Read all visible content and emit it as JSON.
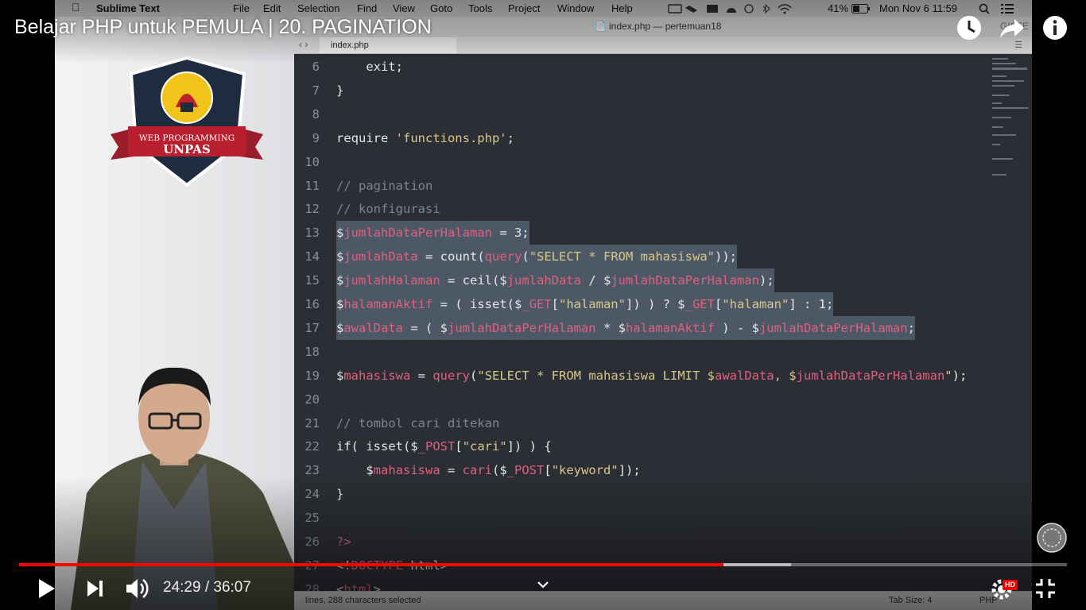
{
  "video": {
    "title": "Belajar PHP untuk PEMULA | 20. PAGINATION",
    "current_time": "24:29",
    "duration": "36:07",
    "time_display": "24:29 / 36:07",
    "played_fraction": 0.672,
    "buffered_fraction": 0.737,
    "hd_badge": "HD",
    "icons": {
      "watch_later": "clock-icon",
      "share": "share-icon",
      "info": "info-icon",
      "play": "play-icon",
      "next": "next-icon",
      "volume": "volume-icon",
      "settings": "gear-icon",
      "exit_fullscreen": "exit-fullscreen-icon",
      "chevron": "chevron-down-icon",
      "channel_watermark": "channel-watermark-icon"
    }
  },
  "mac_menubar": {
    "app": "Sublime Text",
    "menus": [
      "File",
      "Edit",
      "Selection",
      "Find",
      "View",
      "Goto",
      "Tools",
      "Project",
      "Window",
      "Help"
    ],
    "battery": "41%",
    "clock": "Mon Nov 6  11:59"
  },
  "logo": {
    "line1": "WEB PROGRAMMING",
    "line2": "UNPAS"
  },
  "editor": {
    "window_title": "index.php — pertemuan18",
    "tab_label": "index.php",
    "register_hint": "GISTE",
    "status_left": "lines, 288 characters selected",
    "tab_size": "Tab Size: 4",
    "syntax": "PHP",
    "lines": [
      {
        "n": "6",
        "t": "    exit;",
        "sel": false
      },
      {
        "n": "7",
        "t": "}",
        "sel": false
      },
      {
        "n": "8",
        "t": "",
        "sel": false
      },
      {
        "n": "9",
        "t": "require 'functions.php';",
        "sel": false
      },
      {
        "n": "10",
        "t": "",
        "sel": false
      },
      {
        "n": "11",
        "t": "// pagination",
        "sel": false
      },
      {
        "n": "12",
        "t": "// konfigurasi",
        "sel": false
      },
      {
        "n": "13",
        "t": "$jumlahDataPerHalaman = 3;",
        "sel": true
      },
      {
        "n": "14",
        "t": "$jumlahData = count(query(\"SELECT * FROM mahasiswa\"));",
        "sel": true
      },
      {
        "n": "15",
        "t": "$jumlahHalaman = ceil($jumlahData / $jumlahDataPerHalaman);",
        "sel": true
      },
      {
        "n": "16",
        "t": "$halamanAktif = ( isset($_GET[\"halaman\"]) ) ? $_GET[\"halaman\"] : 1;",
        "sel": true
      },
      {
        "n": "17",
        "t": "$awalData = ( $jumlahDataPerHalaman * $halamanAktif ) - $jumlahDataPerHalaman;",
        "sel": true
      },
      {
        "n": "18",
        "t": "",
        "sel": false
      },
      {
        "n": "19",
        "t": "$mahasiswa = query(\"SELECT * FROM mahasiswa LIMIT $awalData, $jumlahDataPerHalaman\");",
        "sel": false
      },
      {
        "n": "20",
        "t": "",
        "sel": false
      },
      {
        "n": "21",
        "t": "// tombol cari ditekan",
        "sel": false
      },
      {
        "n": "22",
        "t": "if( isset($_POST[\"cari\"]) ) {",
        "sel": false
      },
      {
        "n": "23",
        "t": "    $mahasiswa = cari($_POST[\"keyword\"]);",
        "sel": false
      },
      {
        "n": "24",
        "t": "}",
        "sel": false
      },
      {
        "n": "25",
        "t": "",
        "sel": false
      },
      {
        "n": "26",
        "t": "?>",
        "sel": false
      },
      {
        "n": "27",
        "t": "<!DOCTYPE html>",
        "sel": false
      },
      {
        "n": "28",
        "t": "<html>",
        "sel": false
      }
    ]
  },
  "colors": {
    "editor_bg": "#2b2e34",
    "selection": "#5c6a7c",
    "comment": "#7f848e",
    "string": "#d7c88b",
    "variable": "#e0607e",
    "progress_red": "#ff0000"
  }
}
